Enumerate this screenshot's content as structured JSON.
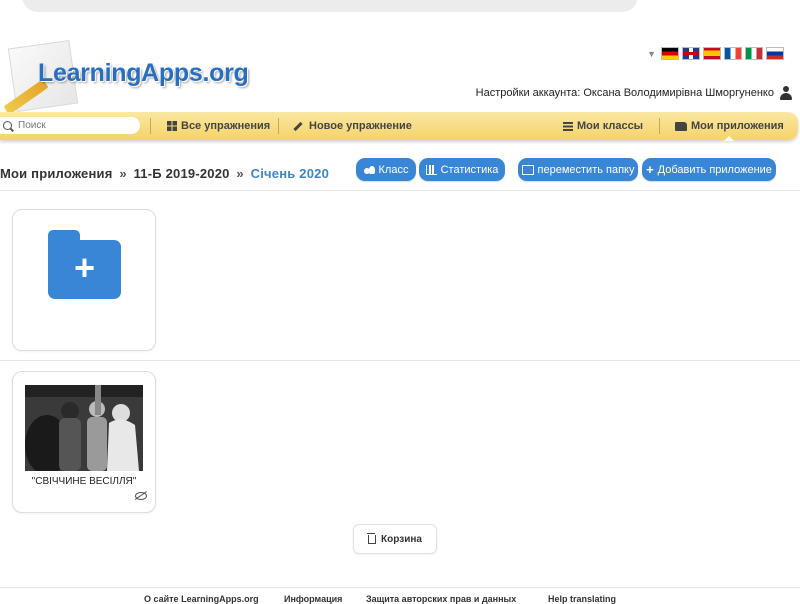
{
  "brand": {
    "logo_text": "LearningApps.org"
  },
  "languages": [
    "de-flag-icon",
    "gb-flag-icon",
    "es-flag-icon",
    "fr-flag-icon",
    "it-flag-icon",
    "ru-flag-icon"
  ],
  "account": {
    "label": "Настройки аккаунта: Оксана Володимирівна Шморгуненко"
  },
  "nav": {
    "search_placeholder": "Поиск",
    "all_exercises": "Все упражнения",
    "new_exercise": "Новое упражнение",
    "my_classes": "Мои классы",
    "my_apps": "Мои приложения"
  },
  "breadcrumb": {
    "root": "Мои приложения",
    "sep": "»",
    "folder": "11-Б 2019-2020",
    "current": "Січень 2020"
  },
  "actions": {
    "class": "Класс",
    "statistics": "Статистика",
    "move_folder": "переместить папку",
    "add_app": "Добавить приложение"
  },
  "apps": [
    {
      "title": "\"СВІЧЧИНЕ ВЕСІЛЛЯ\""
    }
  ],
  "trash": {
    "label": "Корзина"
  },
  "footer": {
    "about": "О сайте LearningApps.org",
    "info": "Информация",
    "privacy": "Защита авторских прав и данных",
    "help": "Help translating"
  },
  "colors": {
    "accent": "#3a86d6",
    "nav_bg": "#f5d36a",
    "breadcrumb_current": "#3f86c4"
  }
}
